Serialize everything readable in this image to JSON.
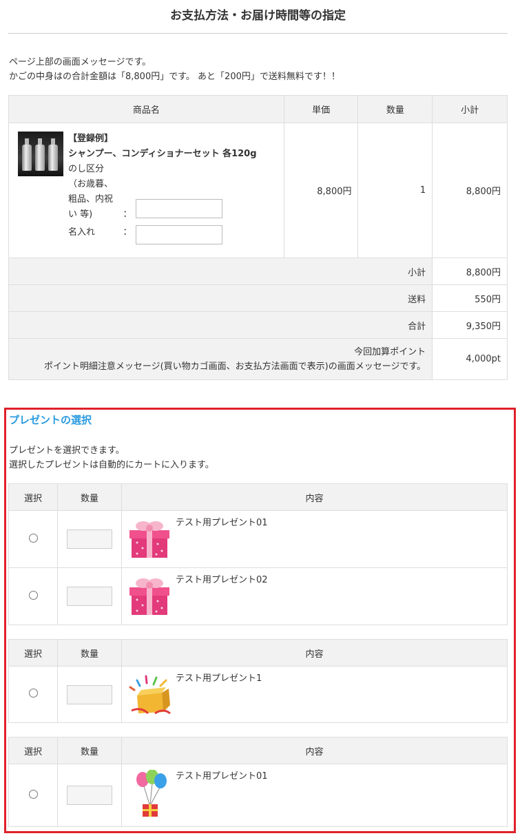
{
  "page": {
    "title": "お支払方法・お届け時間等の指定"
  },
  "message": {
    "line1": "ページ上部の画面メッセージです。",
    "line2": "かごの中身はの合計金額は「8,800円」です。 あと「200円」で送料無料です！！"
  },
  "cart": {
    "headers": {
      "name": "商品名",
      "price": "単価",
      "qty": "数量",
      "subtotal": "小計"
    },
    "item": {
      "tag": "【登録例】",
      "name": "シャンプー、コンディショナーセット 各120g",
      "noshi_label_1": "のし区分",
      "noshi_label_2": "（お歳暮、",
      "noshi_label_3": "粗品、内祝",
      "noshi_label_4": "い 等)",
      "naire_label": "名入れ",
      "colon": "：",
      "price": "8,800円",
      "qty": "1",
      "subtotal": "8,800円",
      "image_icon": "shampoo-bottles-photo"
    },
    "summary": {
      "subtotal_label": "小計",
      "subtotal_value": "8,800円",
      "shipping_label": "送料",
      "shipping_value": "550円",
      "total_label": "合計",
      "total_value": "9,350円",
      "points_label": "今回加算ポイント",
      "points_note": "ポイント明細注意メッセージ(買い物カゴ画面、お支払方法画面で表示)の画面メッセージです。",
      "points_value": "4,000pt"
    }
  },
  "present": {
    "title": "プレゼントの選択",
    "msg1": "プレゼントを選択できます。",
    "msg2": "選択したプレゼントは自動的にカートに入ります。",
    "headers": {
      "select": "選択",
      "qty": "数量",
      "content": "内容"
    },
    "groups": [
      {
        "items": [
          {
            "name": "テスト用プレゼント01",
            "icon": "pink-gift-box-icon"
          },
          {
            "name": "テスト用プレゼント02",
            "icon": "pink-gift-box-icon"
          }
        ]
      },
      {
        "items": [
          {
            "name": "テスト用プレゼント1",
            "icon": "open-gift-confetti-icon"
          }
        ]
      },
      {
        "items": [
          {
            "name": "テスト用プレゼント01",
            "icon": "balloons-gift-icon"
          }
        ]
      }
    ]
  },
  "colors": {
    "accent_blue": "#2b9be0",
    "highlight_red": "#e0202a"
  }
}
